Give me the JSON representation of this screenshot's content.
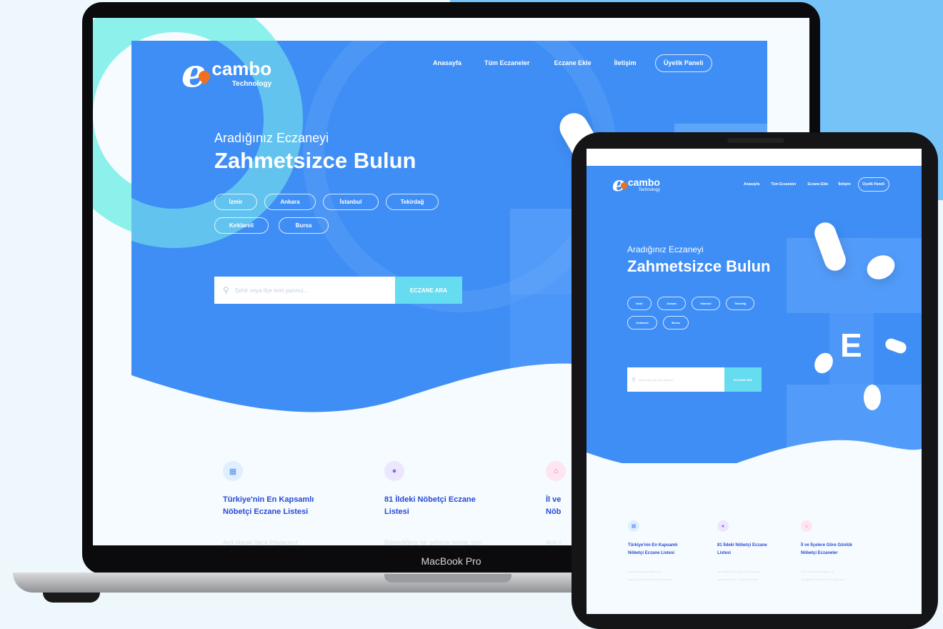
{
  "laptop": {
    "label": "MacBook Pro",
    "site": {
      "brand": {
        "mark": "e",
        "name": "cambo",
        "sub": "Technology"
      },
      "nav": [
        "Anasayfa",
        "Tüm Eczaneler",
        "Eczane Ekle",
        "İletişim"
      ],
      "nav_button": "Üyelik Paneli",
      "hero_sub": "Aradığınız Eczaneyi",
      "hero_title": "Zahmetsizce Bulun",
      "cities": [
        "İzmir",
        "Ankara",
        "İstanbul",
        "Tekirdağ",
        "Kırklareli",
        "Bursa"
      ],
      "search_placeholder": "Şehir veya ilçe ismi yazınız...",
      "search_button": "ECZANE ARA",
      "cards": [
        {
          "title1": "Türkiye'nin En Kapsamlı",
          "title2": "Nöbetçi Eczane Listesi",
          "text": "Acil olarak ilaca ihtiyacınız"
        },
        {
          "title1": "81 İldeki Nöbetçi Eczane",
          "title2": "Listesi",
          "text": "Bilmediğiniz bir şehirde birkaç gün"
        },
        {
          "title1": "İl ve",
          "title2": "Nöb",
          "text": "Acil o"
        }
      ]
    }
  },
  "tablet": {
    "site": {
      "brand": {
        "mark": "e",
        "name": "cambo",
        "sub": "Technology"
      },
      "nav": [
        "Anasayfa",
        "Tüm Eczaneler",
        "Eczane Ekle",
        "İletişim"
      ],
      "nav_button": "Üyelik Paneli",
      "hero_sub": "Aradığınız Eczaneyi",
      "hero_title": "Zahmetsizce Bulun",
      "cities": [
        "İzmir",
        "Ankara",
        "İstanbul",
        "Tekirdağ",
        "Kırklareli",
        "Bursa"
      ],
      "search_placeholder": "Şehir veya ilçe ismi yazınız...",
      "search_button": "ECZANE ARA",
      "letter": "E",
      "cards": [
        {
          "title1": "Türkiye'nin En Kapsamlı",
          "title2": "Nöbetçi Eczane Listesi",
          "text1": "Acil olarak ilaca ihtiyacınız",
          "text2": "olduğunda Türkiye'nin en kapsamlı"
        },
        {
          "title1": "81 İldeki Nöbetçi Eczane",
          "title2": "Listesi",
          "text1": "Bilmediğiniz bir şehirde birkaç gün",
          "text2": "kalmanız gerek. Eczane ararken"
        },
        {
          "title1": "İl ve İlçelere Göre Günlük",
          "title2": "Nöbetçi Eczaneler",
          "text1": "Acil olarak ilaca ihtiyacınız",
          "text2": "olduğunda Türkiye'nin en kapsamlı"
        }
      ]
    }
  },
  "colors": {
    "hero": "#3f8ef5",
    "accent": "#66dcf0",
    "card_title": "#2a4ad6",
    "background": "#eef7fc"
  }
}
